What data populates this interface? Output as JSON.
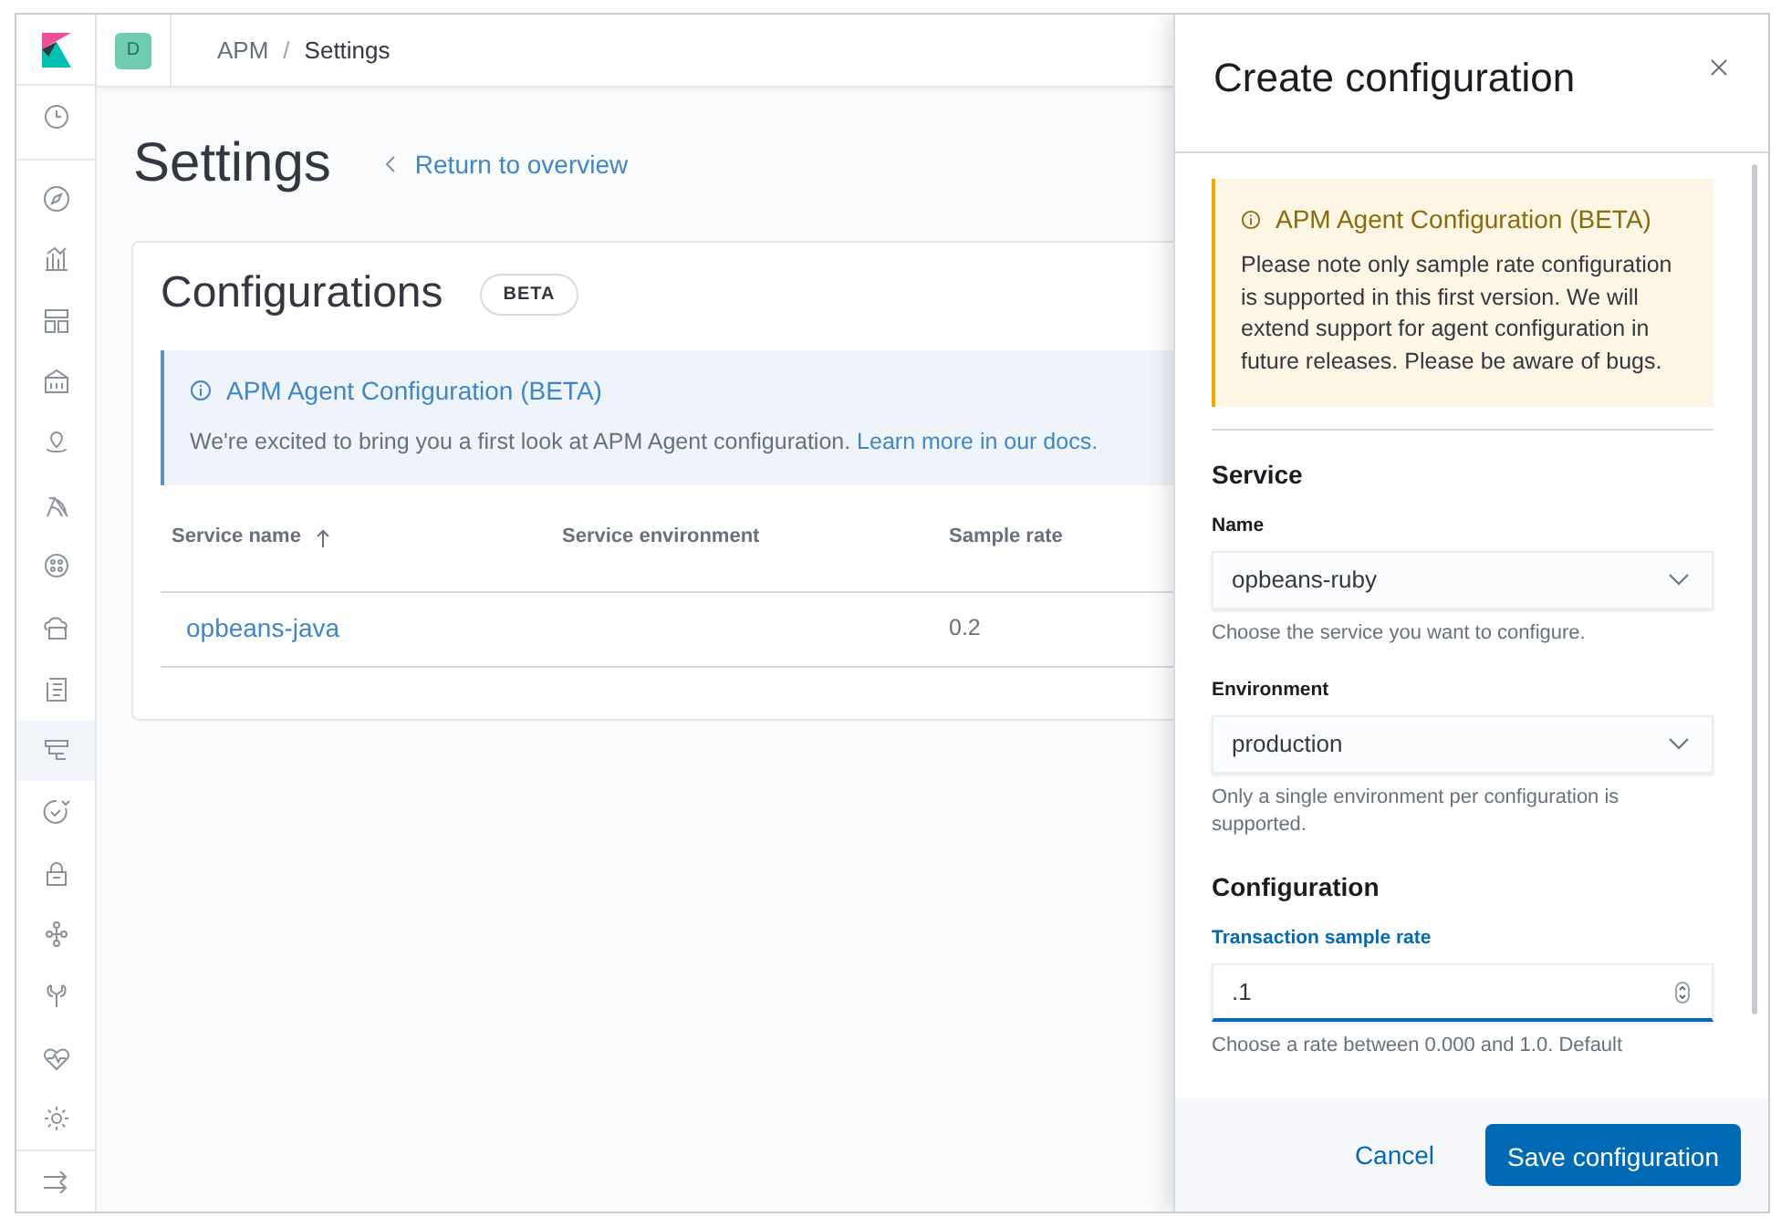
{
  "header": {
    "space_avatar": "D",
    "breadcrumbs": [
      "APM",
      "Settings"
    ],
    "breadcrumb_separator": "/"
  },
  "nav_items": [
    {
      "selected": false
    },
    {
      "selected": false
    },
    {
      "selected": false
    },
    {
      "selected": false
    },
    {
      "selected": false
    },
    {
      "selected": false
    },
    {
      "selected": false
    },
    {
      "selected": false
    },
    {
      "selected": false
    },
    {
      "selected": false
    },
    {
      "selected": true
    },
    {
      "selected": false
    },
    {
      "selected": false
    },
    {
      "selected": false
    },
    {
      "selected": false
    },
    {
      "selected": false
    },
    {
      "selected": false
    }
  ],
  "page": {
    "title": "Settings",
    "back_link": "Return to overview"
  },
  "panel": {
    "title": "Configurations",
    "badge": "BETA",
    "callout": {
      "title": "APM Agent Configuration (BETA)",
      "text": "We're excited to bring you a first look at APM Agent configuration.",
      "link": "Learn more in our docs."
    },
    "table": {
      "columns": [
        {
          "label": "Service name",
          "sorted": true
        },
        {
          "label": "Service environment",
          "sorted": false
        },
        {
          "label": "Sample rate",
          "sorted": false
        }
      ],
      "rows": [
        {
          "service_name": "opbeans-java",
          "sample_rate": "0.2"
        }
      ]
    }
  },
  "flyout": {
    "title": "Create configuration",
    "callout": {
      "title": "APM Agent Configuration (BETA)",
      "text": "Please note only sample rate configuration is supported in this first version. We will extend support for agent configuration in future releases. Please be aware of bugs."
    },
    "sections": [
      {
        "title": "Service",
        "fields": [
          {
            "kind": "select",
            "label": "Name",
            "value": "opbeans-ruby",
            "help": "Choose the service you want to configure.",
            "focused": false
          },
          {
            "kind": "select",
            "label": "Environment",
            "value": "production",
            "help": "Only a single environment per configuration is supported.",
            "focused": false
          }
        ]
      },
      {
        "title": "Configuration",
        "fields": [
          {
            "kind": "number",
            "label": "Transaction sample rate",
            "value": ".1",
            "help": "Choose a rate between 0.000 and 1.0. Default",
            "focused": true
          }
        ]
      }
    ],
    "buttons": [
      {
        "label": "Cancel",
        "kind": "link"
      },
      {
        "label": "Save configuration",
        "kind": "primary"
      }
    ]
  }
}
